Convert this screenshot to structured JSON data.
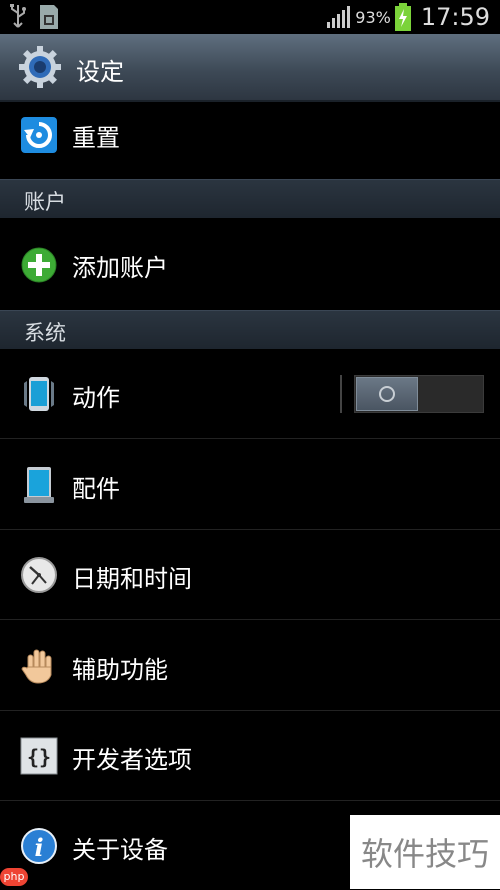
{
  "status_bar": {
    "battery_percent": "93%",
    "time": "17:59",
    "icons": [
      "usb-icon",
      "sd-card-icon",
      "signal-icon",
      "battery-charging-icon"
    ]
  },
  "header": {
    "title": "设定",
    "icon": "settings-gear-icon"
  },
  "items": {
    "reset": {
      "label": "重置",
      "icon": "reset-icon"
    },
    "add_account": {
      "label": "添加账户",
      "icon": "add-account-icon"
    },
    "motion": {
      "label": "动作",
      "icon": "motion-phone-icon",
      "toggle_on": false
    },
    "accessory": {
      "label": "配件",
      "icon": "accessory-dock-icon"
    },
    "date_time": {
      "label": "日期和时间",
      "icon": "clock-icon"
    },
    "accessibility": {
      "label": "辅助功能",
      "icon": "hand-icon"
    },
    "developer": {
      "label": "开发者选项",
      "icon": "braces-icon"
    },
    "about": {
      "label": "关于设备",
      "icon": "info-icon"
    }
  },
  "sections": {
    "account": "账户",
    "system": "系统"
  },
  "watermark": {
    "text": "软件技巧",
    "logo": "php"
  },
  "colors": {
    "add_green": "#3dab35",
    "info_blue": "#2a7fd4",
    "titlebar": "#4b5966"
  }
}
